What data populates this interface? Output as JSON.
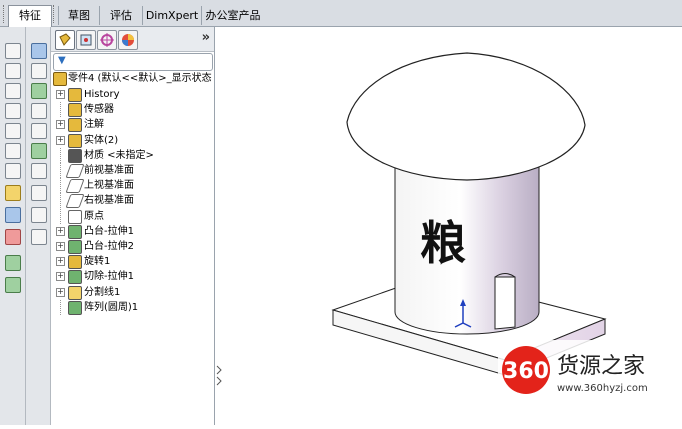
{
  "tabs": [
    {
      "label": "特征"
    },
    {
      "label": "草图"
    },
    {
      "label": "评估"
    },
    {
      "label": "DimXpert"
    },
    {
      "label": "办公室产品"
    }
  ],
  "feature_tree": {
    "root": "零件4 (默认<<默认>_显示状态",
    "items": [
      {
        "label": "History",
        "expand": "+",
        "icon": "history-icon"
      },
      {
        "label": "传感器",
        "expand": "",
        "icon": "sensor-icon"
      },
      {
        "label": "注解",
        "expand": "+",
        "icon": "annotation-icon"
      },
      {
        "label": "实体(2)",
        "expand": "+",
        "icon": "solid-body-icon"
      },
      {
        "label": "材质 <未指定>",
        "expand": "",
        "icon": "material-icon"
      },
      {
        "label": "前视基准面",
        "expand": "",
        "icon": "plane-icon"
      },
      {
        "label": "上视基准面",
        "expand": "",
        "icon": "plane-icon"
      },
      {
        "label": "右视基准面",
        "expand": "",
        "icon": "plane-icon"
      },
      {
        "label": "原点",
        "expand": "",
        "icon": "origin-icon"
      },
      {
        "label": "凸台-拉伸1",
        "expand": "+",
        "icon": "boss-extrude-icon"
      },
      {
        "label": "凸台-拉伸2",
        "expand": "+",
        "icon": "boss-extrude-icon"
      },
      {
        "label": "旋转1",
        "expand": "+",
        "icon": "revolve-icon"
      },
      {
        "label": "切除-拉伸1",
        "expand": "+",
        "icon": "cut-extrude-icon"
      },
      {
        "label": "分割线1",
        "expand": "+",
        "icon": "split-line-icon"
      },
      {
        "label": "阵列(圆周)1",
        "expand": "",
        "icon": "circular-pattern-icon"
      }
    ]
  },
  "model": {
    "engraved_text": "粮"
  },
  "watermark": {
    "badge": "360",
    "title": "货源之家",
    "url": "www.360hyzj.com"
  },
  "colors": {
    "accent": "#e3231a",
    "toolbar": "#e3e6ea"
  }
}
